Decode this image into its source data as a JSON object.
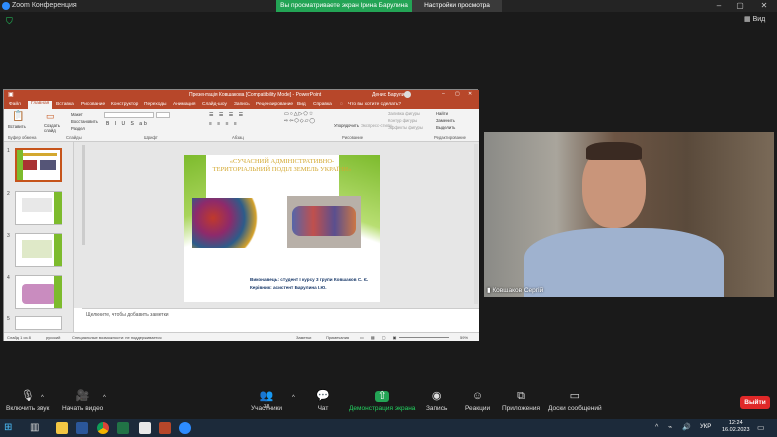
{
  "zoom": {
    "title": "Zoom Конференция",
    "share_banner": "Вы просматриваете экран Ірина Барулина",
    "view_settings": "Настройки просмотра",
    "view_button": "Вид",
    "participants_count": "18",
    "toolbar": {
      "mute": "Включить звук",
      "video": "Начать видео",
      "participants": "Участники",
      "chat": "Чат",
      "share": "Демонстрация экрана",
      "record": "Запись",
      "reactions": "Реакции",
      "apps": "Приложения",
      "whiteboards": "Доски сообщений",
      "end": "Выйти"
    }
  },
  "ppt": {
    "title": "Презентація Ковшакова [Compatibility Mode] - PowerPoint",
    "user": "Денис Барулин",
    "tabs": [
      "Файл",
      "Главная",
      "Вставка",
      "Рисование",
      "Конструктор",
      "Переходы",
      "Анимация",
      "Слайд-шоу",
      "Запись",
      "Рецензирование",
      "Вид",
      "Справка",
      "Что вы хотите сделать?"
    ],
    "ribbon": {
      "paste": "Вставить",
      "new_slide": "Создать слайд",
      "clipboard": "Буфер обмена",
      "slides": "Слайды",
      "layout": "Макет",
      "reset": "Восстановить",
      "section": "Раздел",
      "font": "Шрифт",
      "paragraph": "Абзац",
      "drawing": "Рисование",
      "arrange": "Упорядочить",
      "quick_styles": "Экспресс-стили",
      "find": "Найти",
      "replace": "Заменить",
      "select": "Выделить",
      "editing": "Редактирование",
      "fill": "Заливка фигуры",
      "outline": "Контур фигуры",
      "effects": "Эффекты фигуры"
    },
    "slide": {
      "title": "«СУЧАСНИЙ АДМІНІСТРАТИВНО-ТЕРИТОРІАЛЬНИЙ ПОДІЛ ЗЕМЕЛЬ УКРАЇНИ»",
      "info1": "Виконавець: студент І курсу 3 групи Ковшаков С. Є.",
      "info2": "Керівник: асистент Барулина І.Ю."
    },
    "thumb_numbers": [
      "1",
      "2",
      "3",
      "4",
      "5"
    ],
    "notes_placeholder": "Щелкните, чтобы добавить заметки",
    "status": {
      "slide": "Слайд 1 из 8",
      "lang": "русский",
      "accessibility": "Специальные возможности: не поддерживается",
      "notes": "Заметки",
      "comments": "Примечания",
      "zoom": "59%"
    }
  },
  "webcam": {
    "name": "Ковшаков Сергій"
  },
  "taskbar": {
    "lang": "УКР",
    "time": "12:24",
    "date": "16.02.2023"
  },
  "colors": {
    "ppt_accent": "#b7472a",
    "share_green": "#23a455",
    "end_red": "#e02828"
  }
}
